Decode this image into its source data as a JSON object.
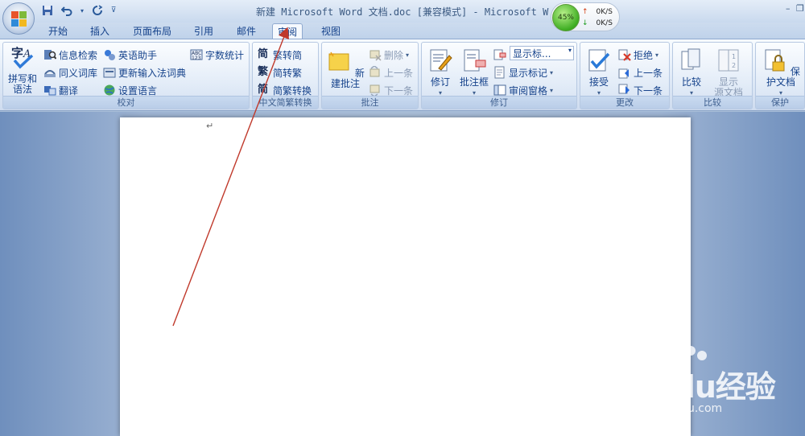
{
  "window": {
    "title": "新建 Microsoft Word 文档.doc [兼容模式] - Microsoft W",
    "minimize_glyph": "–",
    "restore_glyph": "❐"
  },
  "quick_access": {
    "icons": [
      "save-icon",
      "undo-icon",
      "redo-icon",
      "customize-icon"
    ]
  },
  "network_widget": {
    "percent": "45%",
    "up_rate": "0K/S",
    "down_rate": "0K/S"
  },
  "tabs": [
    {
      "label": "开始"
    },
    {
      "label": "插入"
    },
    {
      "label": "页面布局"
    },
    {
      "label": "引用"
    },
    {
      "label": "邮件"
    },
    {
      "label": "审阅",
      "active": true
    },
    {
      "label": "视图"
    }
  ],
  "ribbon": {
    "proofing": {
      "label": "校对",
      "spell": "拼写和\n语法",
      "research": "信息检索",
      "thesaurus": "同义词库",
      "translate": "翻译",
      "english_assistant": "英语助手",
      "update_ime": "更新输入法词典",
      "set_language": "设置语言",
      "word_count": "字数统计"
    },
    "chinese_conversion": {
      "label": "中文简繁转换",
      "to_simplified": "繁转简",
      "to_traditional": "简转繁",
      "conversion": "简繁转换"
    },
    "comments": {
      "label": "批注",
      "new_comment": "新建批注",
      "delete": "删除",
      "previous": "上一条",
      "next": "下一条"
    },
    "tracking": {
      "label": "修订",
      "track_changes": "修订",
      "balloons": "批注框",
      "display_combo": "显示标...",
      "show_markup": "显示标记",
      "reviewing_pane": "审阅窗格"
    },
    "changes": {
      "label": "更改",
      "accept": "接受",
      "reject": "拒绝",
      "previous": "上一条",
      "next": "下一条"
    },
    "compare": {
      "label": "比较",
      "compare": "比较",
      "show_source": "显示\n源文档"
    },
    "protect": {
      "label": "保护",
      "protect_document": "保护文档"
    }
  },
  "document": {
    "paragraph_mark": "↵"
  },
  "watermark": {
    "brand": "Baidu经验",
    "url": "jingyan.baidu.com"
  },
  "colors": {
    "ribbon_text": "#15428b",
    "annotation_arrow": "#c0392b"
  }
}
